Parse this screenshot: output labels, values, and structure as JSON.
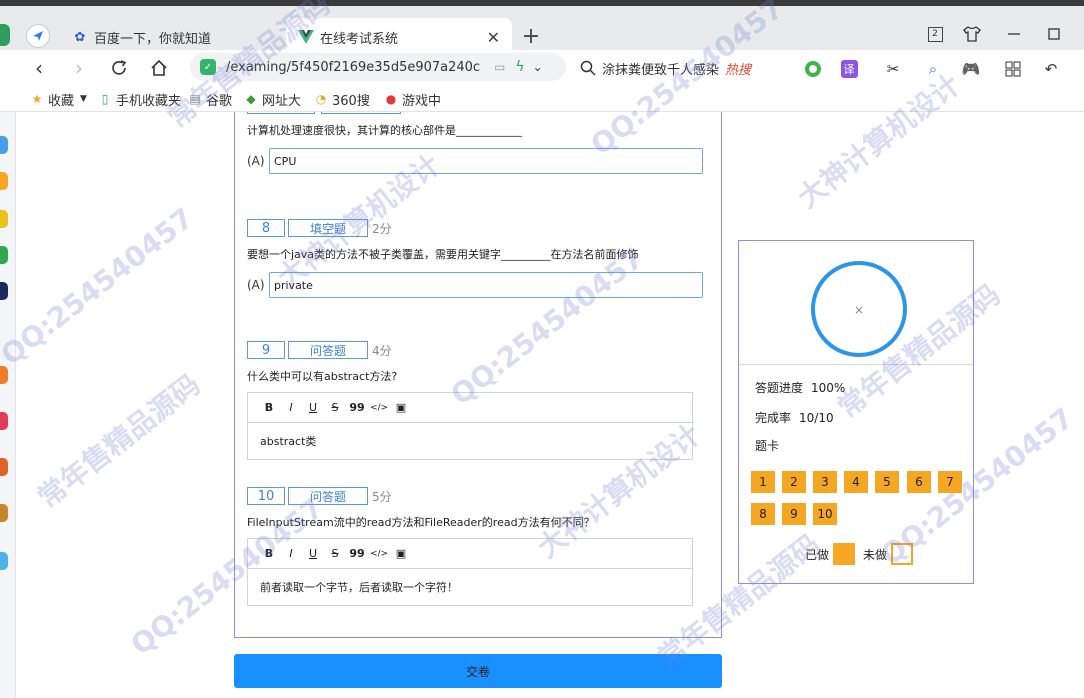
{
  "browser": {
    "tabs": [
      {
        "label": "百度一下，你就知道",
        "icon": "paw-icon"
      },
      {
        "label": "在线考试系统",
        "icon": "vue-icon"
      }
    ],
    "new_tab_label": "+",
    "url": "/examing/5f450f2169e35d5e907a240c",
    "search_text": "涂抹粪便致千人感染",
    "search_hot": "热搜",
    "win_badge": "2",
    "translate_label": "译",
    "bookmarks": [
      {
        "label": "收藏",
        "icon": "star-icon"
      },
      {
        "label": "手机收藏夹",
        "icon": "phone-icon"
      },
      {
        "label": "谷歌",
        "icon": "doc-icon"
      },
      {
        "label": "网址大",
        "icon": "globe-icon"
      },
      {
        "label": "360搜",
        "icon": "search360-icon"
      },
      {
        "label": "游戏中",
        "icon": "game-icon"
      }
    ]
  },
  "exam": {
    "questions": [
      {
        "text": "计算机处理速度很快，其计算的核心部件是____________",
        "option_label": "(A)",
        "answer": "CPU"
      },
      {
        "number": "8",
        "type": "填空题",
        "score": "2分",
        "text": "要想一个java类的方法不被子类覆盖，需要用关键字_________在方法名前面修饰",
        "option_label": "(A)",
        "answer": "private"
      },
      {
        "number": "9",
        "type": "问答题",
        "score": "4分",
        "text": "什么类中可以有abstract方法?",
        "answer": "abstract类"
      },
      {
        "number": "10",
        "type": "问答题",
        "score": "5分",
        "text": "FileInputStream流中的read方法和FileReader的read方法有何不同？",
        "answer": "前者读取一个字节，后者读取一个字符！"
      }
    ],
    "editor_tools": [
      "B",
      "I",
      "U",
      "S",
      "99",
      "</>",
      "▣"
    ],
    "submit_label": "交卷"
  },
  "progress": {
    "ring_center": "×",
    "progress_label": "答题进度",
    "progress_value": "100%",
    "progress_fraction": 1.0,
    "completion_label": "完成率",
    "completion_value": "10/10",
    "card_label": "题卡",
    "cells": [
      "1",
      "2",
      "3",
      "4",
      "5",
      "6",
      "7",
      "8",
      "9",
      "10"
    ],
    "legend_done": "已做",
    "legend_undone": "未做",
    "accent": "#2b95e9",
    "done_color": "#f5a623"
  },
  "watermarks": [
    "QQ:254540457",
    "常年售精品源码",
    "大神计算机设计"
  ]
}
